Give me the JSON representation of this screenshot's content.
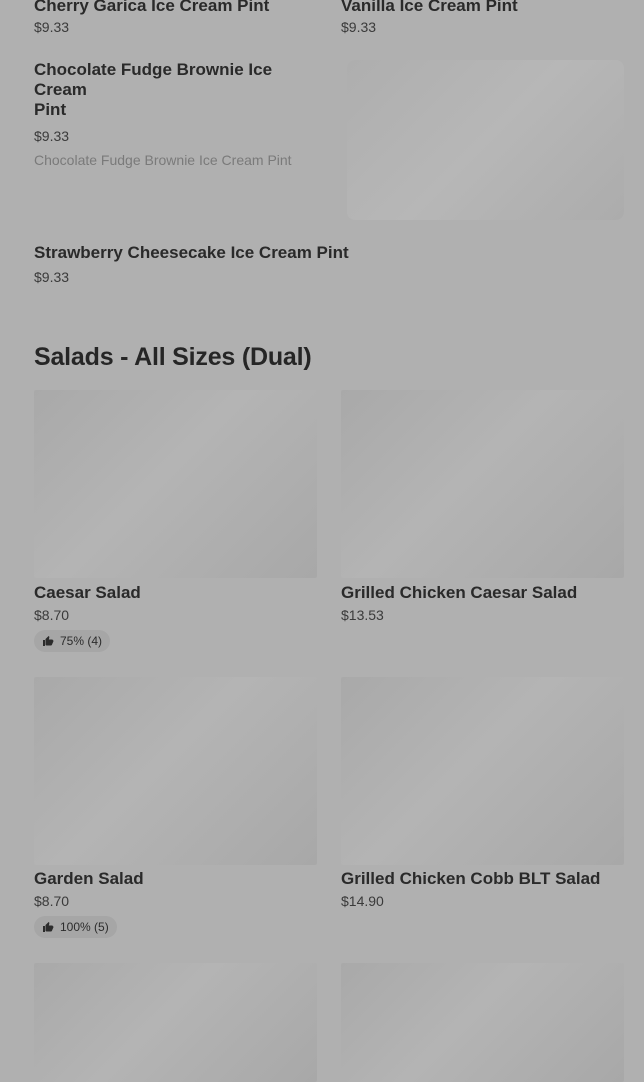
{
  "top_items": [
    {
      "name": "Cherry Garica Ice Cream Pint",
      "price": "$9.33"
    },
    {
      "name": "Vanilla Ice Cream Pint",
      "price": "$9.33"
    }
  ],
  "featured_item": {
    "name_line1": "Chocolate Fudge Brownie Ice Cream",
    "name_line2": "Pint",
    "price": "$9.33",
    "description": "Chocolate Fudge Brownie Ice Cream Pint"
  },
  "single_item": {
    "name": "Strawberry Cheesecake Ice Cream Pint",
    "price": "$9.33"
  },
  "section": {
    "title": "Salads - All Sizes (Dual)"
  },
  "salads": [
    {
      "name": "Caesar Salad",
      "price": "$8.70",
      "rating": "75% (4)"
    },
    {
      "name": "Grilled Chicken Caesar Salad",
      "price": "$13.53"
    },
    {
      "name": "Garden Salad",
      "price": "$8.70",
      "rating": "100% (5)"
    },
    {
      "name": "Grilled Chicken Cobb BLT Salad",
      "price": "$14.90"
    }
  ],
  "icons": {
    "rating": "thumbs-up-icon"
  },
  "colors": {
    "overlay": "#b0b0b0"
  }
}
